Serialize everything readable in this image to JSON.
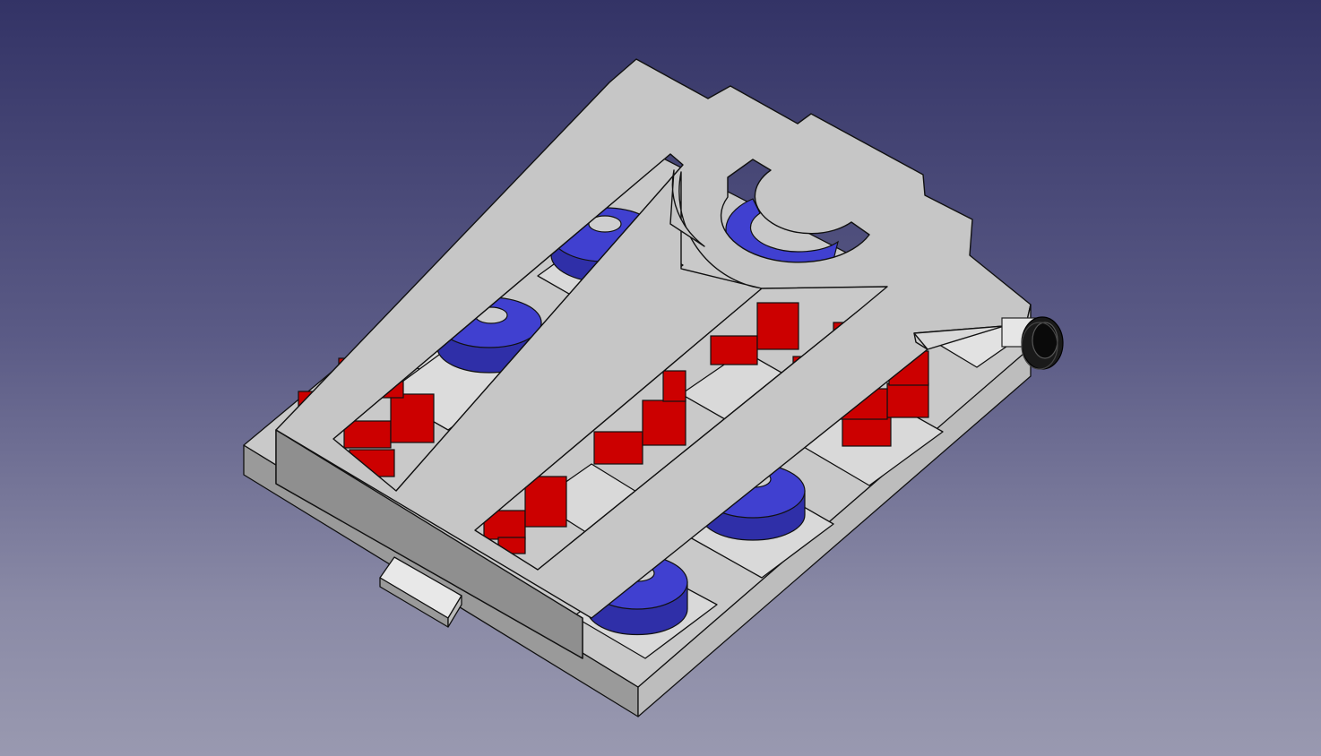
{
  "viewport": {
    "background_top": "#333366",
    "background_bottom": "#9999b0"
  },
  "model": {
    "body_color": "#c8c8c8",
    "body_shadow": "#8a8a8a",
    "body_light": "#e6e6e6",
    "edge_color": "#111111",
    "bearing_color": "#3f3fcf",
    "bearing_dark": "#2e2e9e",
    "block_color": "#cc0000",
    "block_dark": "#8f0000",
    "knob_color": "#101010"
  }
}
